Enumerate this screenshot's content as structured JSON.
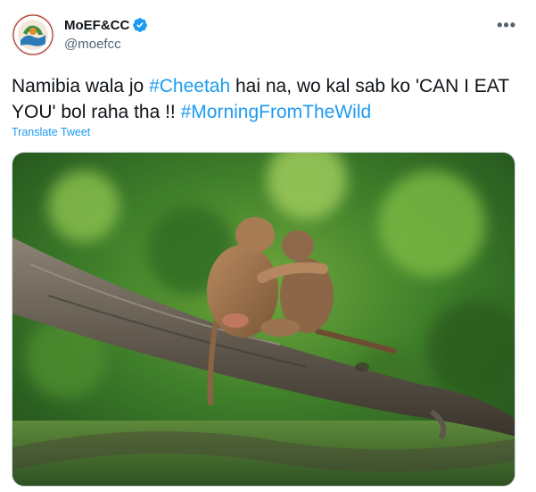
{
  "account": {
    "display_name": "MoEF&CC",
    "handle": "@moefcc",
    "verified_icon": "verified-badge-icon",
    "avatar_icon": "ministry-emblem-logo"
  },
  "menu": {
    "more_label": "•••"
  },
  "tweet": {
    "text_parts": [
      "Namibia wala jo ",
      "#Cheetah",
      " hai na, wo kal sab ko 'CAN I EAT YOU' bol raha tha !! ",
      "#MorningFromTheWild"
    ],
    "translate_label": "Translate Tweet"
  },
  "media": {
    "subject": "two-monkeys-hugging-on-branch-photo"
  },
  "colors": {
    "link": "#1d9bf0",
    "text": "#0f1419",
    "secondary": "#536471"
  }
}
